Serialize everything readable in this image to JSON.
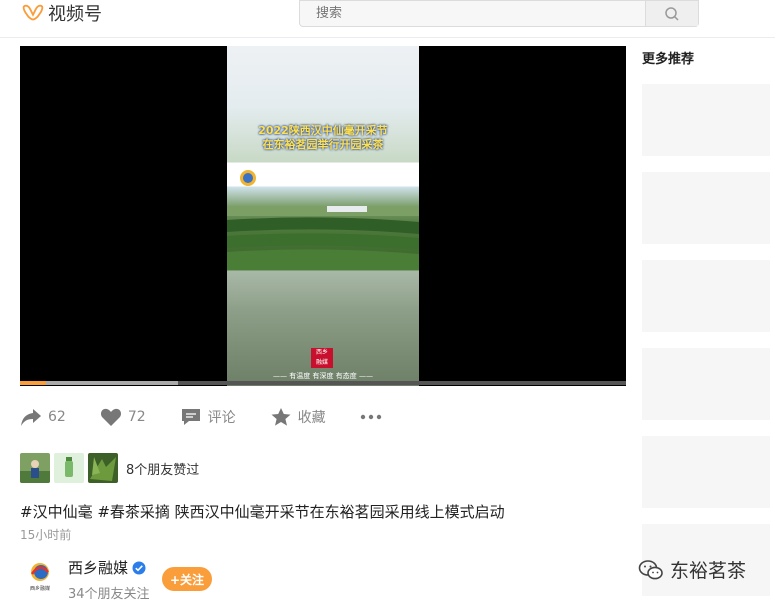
{
  "header": {
    "app_name": "视频号",
    "search_placeholder": "搜索"
  },
  "video": {
    "overlay_title_line1": "2022陕西汉中仙毫开采节",
    "overlay_title_line2": "在东裕茗园举行开园采茶",
    "stamp_text_line1": "西乡",
    "stamp_text_line2": "融媒",
    "footer_text": "—— 有温度 有深度 有态度 ——",
    "progress_played": 0.043,
    "progress_buffered": 0.26
  },
  "actions": {
    "share_count": "62",
    "like_count": "72",
    "comment_label": "评论",
    "favorite_label": "收藏"
  },
  "friends_liked": {
    "text": "8个朋友赞过"
  },
  "post": {
    "description": "#汉中仙毫 #春茶采摘 陕西汉中仙毫开采节在东裕茗园采用线上模式启动",
    "time": "15小时前"
  },
  "author": {
    "name": "西乡融媒",
    "follow_label": "+关注",
    "followers_text": "34个朋友关注",
    "avatar_caption": "西乡融媒"
  },
  "sidebar": {
    "title": "更多推荐"
  },
  "watermark": {
    "text": "东裕茗茶"
  },
  "colors": {
    "accent": "#fa9d3b",
    "verified": "#2b7de9"
  }
}
